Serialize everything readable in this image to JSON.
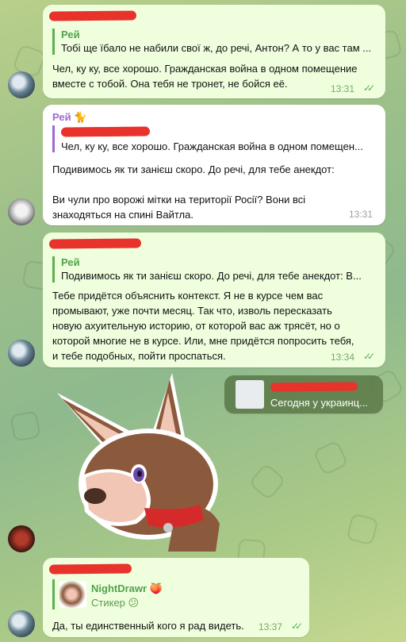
{
  "messages": [
    {
      "reply_name": "Рей",
      "reply_text": "Тобі ще їбало не набили свої ж, до речі, Антон? А то у вас там ...",
      "text_lines": [
        "Чел, ку ку, все хорошо. Гражданская война в одном помещение",
        "вместе с тобой. Она тебя не тронет, не бойся её."
      ],
      "time": "13:31"
    },
    {
      "sender": "Рей",
      "sender_emoji": "🐈",
      "reply_text": "Чел, ку ку, все хорошо. Гражданская война в одном помещен...",
      "text_lines": [
        "Подивимось як ти занієш скоро. До речі, для тебе анекдот:",
        "",
        "Ви чули про ворожі мітки на території Росії? Вони всі",
        "знаходяться на спині Вайтла."
      ],
      "time": "13:31"
    },
    {
      "reply_name": "Рей",
      "reply_text": "Подивимось як ти занієш скоро. До речі, для тебе анекдот:  В...",
      "text_lines": [
        "Тебе придётся объяснить контекст. Я не в курсе чем вас",
        "промывают, уже почти месяц. Так что, изволь пересказать",
        "новую ахуительную историю, от которой вас аж трясёт, но о",
        "которой многие не в курсе. Или, мне придётся попросить тебя,",
        "и тебе подобных, пойти проспаться."
      ],
      "time": "13:34"
    },
    {
      "forward_text": "Сегодня у украинц..."
    },
    {
      "reply_name": "NightDrawr",
      "reply_emoji": "🍑",
      "reply_text": "Стикер",
      "reply_text_emoji": "😕",
      "text_lines": [
        "Да, ты единственный кого я рад видеть."
      ],
      "time": "13:37"
    }
  ],
  "colors": {
    "outgoing_bubble": "#effedd",
    "incoming_bubble": "#ffffff",
    "reply_green": "#4fa34a",
    "sender_purple": "#9b6ad3",
    "redaction_red": "#e8322c"
  }
}
